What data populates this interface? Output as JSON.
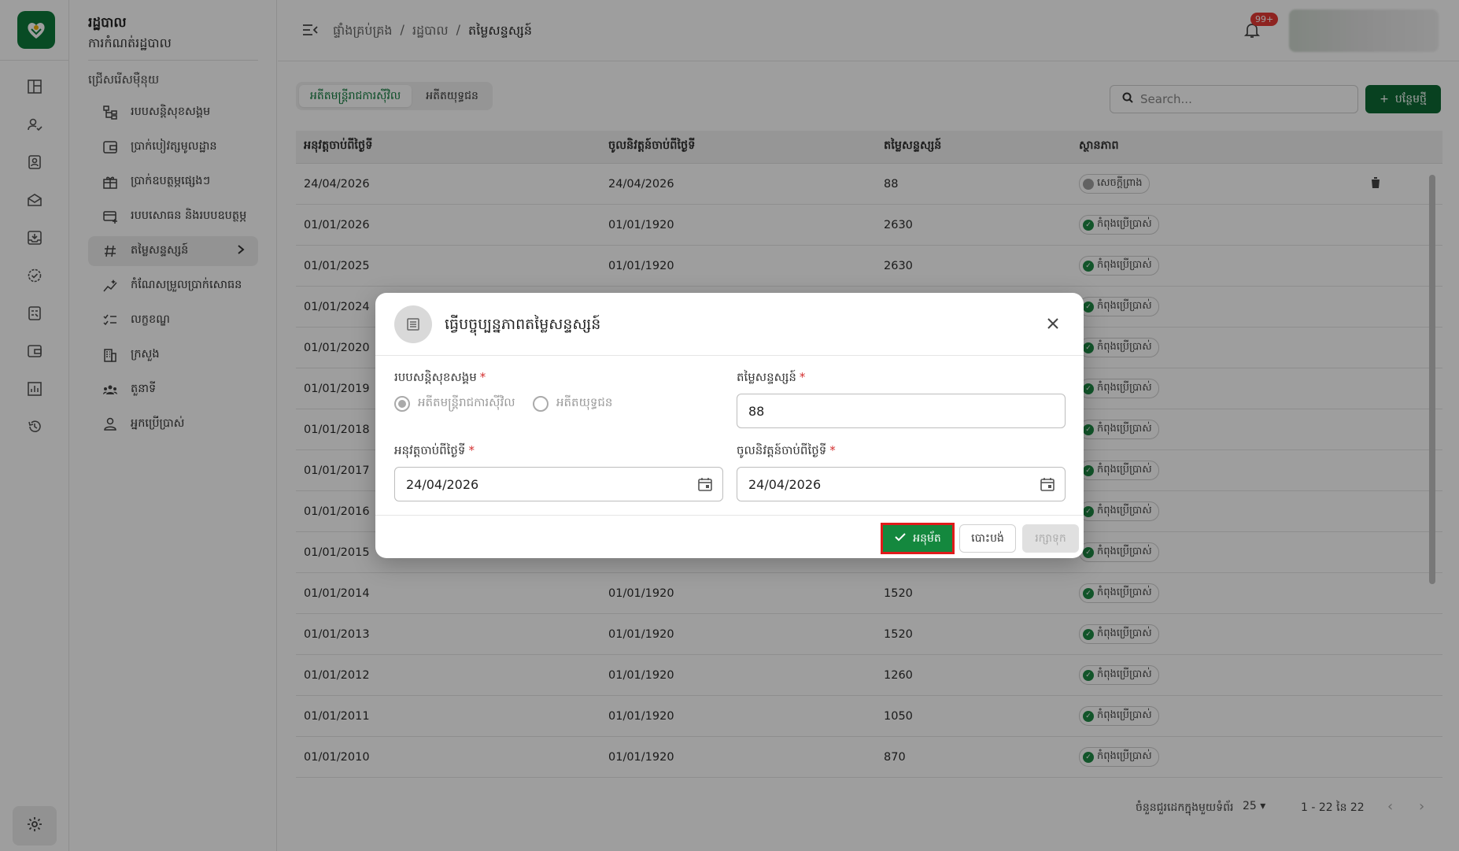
{
  "sidebar": {
    "title": "រដ្ឋបាល",
    "subtitle": "ការកំណត់រដ្ឋបាល",
    "section": "ជ្រើសរើសម៉ឺនុយ",
    "items": [
      {
        "label": "របបសន្តិសុខសង្គម",
        "icon": "hierarchy-icon"
      },
      {
        "label": "ប្រាក់បៀវត្សមូលដ្ឋាន",
        "icon": "wallet-icon"
      },
      {
        "label": "ប្រាក់ឧបត្ថម្ភផ្សេងៗ",
        "icon": "gift-icon"
      },
      {
        "label": "របបសោធន និងរបបឧបត្ថម្ភ",
        "icon": "card-add-icon"
      },
      {
        "label": "តម្លៃសន្ទស្សន៍",
        "icon": "hash-icon"
      },
      {
        "label": "កំណែសម្រួលប្រាក់សោធន",
        "icon": "sparkle-chart-icon"
      },
      {
        "label": "លក្ខខណ្ឌ",
        "icon": "checklist-icon"
      },
      {
        "label": "ក្រសួង",
        "icon": "building-icon"
      },
      {
        "label": "តួនាទី",
        "icon": "group-icon"
      },
      {
        "label": "អ្នកប្រើប្រាស់",
        "icon": "user-icon"
      }
    ]
  },
  "topbar": {
    "breadcrumb": [
      "ផ្ទាំងគ្រប់គ្រង",
      "/",
      "រដ្ឋបាល",
      "/",
      "តម្លៃសន្ទស្សន៍"
    ],
    "notification_badge": "99+"
  },
  "tabs": [
    "អតីតមន្ត្រីរាជការស៊ីវិល",
    "អតីតយុទ្ធជន"
  ],
  "search": {
    "placeholder": "Search..."
  },
  "add_button": "បន្ថែមថ្មី",
  "table": {
    "headers": [
      "អនុវត្តចាប់ពីថ្ងៃទី",
      "ចូលនិវត្តន៍ចាប់ពីថ្ងៃទី",
      "តម្លៃសន្ទស្សន៍",
      "ស្ថានភាព"
    ],
    "rows": [
      {
        "applied": "24/04/2026",
        "retired": "24/04/2026",
        "index": "88",
        "status": "សេចក្តីព្រាង",
        "draft": true
      },
      {
        "applied": "01/01/2026",
        "retired": "01/01/1920",
        "index": "2630",
        "status": "កំពុងប្រើប្រាស់",
        "draft": false
      },
      {
        "applied": "01/01/2025",
        "retired": "01/01/1920",
        "index": "2630",
        "status": "កំពុងប្រើប្រាស់",
        "draft": false
      },
      {
        "applied": "01/01/2024",
        "retired": "",
        "index": "",
        "status": "កំពុងប្រើប្រាស់",
        "draft": false
      },
      {
        "applied": "01/01/2020",
        "retired": "",
        "index": "",
        "status": "កំពុងប្រើប្រាស់",
        "draft": false
      },
      {
        "applied": "01/01/2019",
        "retired": "",
        "index": "",
        "status": "កំពុងប្រើប្រាស់",
        "draft": false
      },
      {
        "applied": "01/01/2018",
        "retired": "",
        "index": "",
        "status": "កំពុងប្រើប្រាស់",
        "draft": false
      },
      {
        "applied": "01/01/2017",
        "retired": "",
        "index": "",
        "status": "កំពុងប្រើប្រាស់",
        "draft": false
      },
      {
        "applied": "01/01/2016",
        "retired": "",
        "index": "",
        "status": "កំពុងប្រើប្រាស់",
        "draft": false
      },
      {
        "applied": "01/01/2015",
        "retired": "",
        "index": "",
        "status": "កំពុងប្រើប្រាស់",
        "draft": false
      },
      {
        "applied": "01/01/2014",
        "retired": "01/01/1920",
        "index": "1520",
        "status": "កំពុងប្រើប្រាស់",
        "draft": false
      },
      {
        "applied": "01/01/2013",
        "retired": "01/01/1920",
        "index": "1520",
        "status": "កំពុងប្រើប្រាស់",
        "draft": false
      },
      {
        "applied": "01/01/2012",
        "retired": "01/01/1920",
        "index": "1260",
        "status": "កំពុងប្រើប្រាស់",
        "draft": false
      },
      {
        "applied": "01/01/2011",
        "retired": "01/01/1920",
        "index": "1050",
        "status": "កំពុងប្រើប្រាស់",
        "draft": false
      },
      {
        "applied": "01/01/2010",
        "retired": "01/01/1920",
        "index": "870",
        "status": "កំពុងប្រើប្រាស់",
        "draft": false
      }
    ]
  },
  "pagination": {
    "rows_per_page_label": "ចំនួនជួរដេកក្នុងមួយទំព័រ",
    "rows_per_page": "25",
    "range": "1 - 22 នៃ 22"
  },
  "modal": {
    "title": "ធ្វើបច្ចុប្បន្នភាពតម្លៃសន្ទស្សន៍",
    "scheme_label": "របបសន្តិសុខសង្គម",
    "scheme_options": [
      "អតីតមន្ត្រីរាជការស៊ីវិល",
      "អតីតយុទ្ធជន"
    ],
    "index_label": "តម្លៃសន្ទស្សន៍",
    "index_value": "88",
    "applied_label": "អនុវត្តចាប់ពីថ្ងៃទី",
    "applied_value": "24/04/2026",
    "retired_label": "ចូលនិវត្តន៍ចាប់ពីថ្ងៃទី",
    "retired_value": "24/04/2026",
    "required_mark": "*",
    "approve_label": "អនុម័ត",
    "cancel_label": "បោះបង់",
    "save_label": "រក្សាទុក"
  },
  "colors": {
    "brand": "#0d6a34",
    "approve": "#14883e",
    "highlight_border": "#e01b1b"
  }
}
